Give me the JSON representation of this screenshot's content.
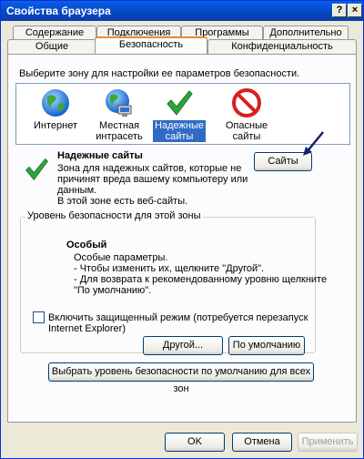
{
  "window": {
    "title": "Свойства браузера",
    "help_btn": "?",
    "close_btn": "×"
  },
  "tabs": {
    "row_top": [
      "Содержание",
      "Подключения",
      "Программы",
      "Дополнительно"
    ],
    "row_bottom": [
      "Общие",
      "Безопасность",
      "Конфиденциальность"
    ],
    "active": "Безопасность"
  },
  "security": {
    "zone_prompt": "Выберите зону для настройки ее параметров безопасности.",
    "zones": [
      {
        "label_line1": "Интернет",
        "label_line2": "",
        "icon": "globe-icon"
      },
      {
        "label_line1": "Местная",
        "label_line2": "интрасеть",
        "icon": "intranet-globe-icon"
      },
      {
        "label_line1": "Надежные",
        "label_line2": "сайты",
        "icon": "checkmark-icon",
        "selected": true
      },
      {
        "label_line1": "Опасные",
        "label_line2": "сайты",
        "icon": "no-entry-icon"
      }
    ],
    "selected_zone": {
      "title": "Надежные сайты",
      "description_lines": [
        "Зона для надежных сайтов, которые не",
        "причинят вреда вашему компьютеру или",
        "данным.",
        "В этой зоне есть веб-сайты."
      ],
      "sites_button": "Сайты"
    },
    "level_group": {
      "title": "Уровень безопасности для этой зоны",
      "level_name": "Особый",
      "level_lines": [
        "Особые параметры.",
        "- Чтобы изменить их, щелкните \"Другой\".",
        "- Для возврата к рекомендованному уровню щелкните",
        "\"По умолчанию\"."
      ],
      "protected_mode_line1": "Включить защищенный режим (потребуется перезапуск",
      "protected_mode_line2": "Internet Explorer)",
      "protected_mode_checked": false,
      "custom_button": "Другой...",
      "default_button": "По умолчанию"
    },
    "reset_all_button": "Выбрать уровень безопасности по умолчанию для всех зон"
  },
  "footer": {
    "ok": "OK",
    "cancel": "Отмена",
    "apply": "Применить"
  },
  "colors": {
    "titlebar": "#0a5fe8",
    "selection": "#316ac5",
    "active_tab_accent": "#e68b2c",
    "check_green": "#2ea33a",
    "no_entry_red": "#d92020"
  }
}
